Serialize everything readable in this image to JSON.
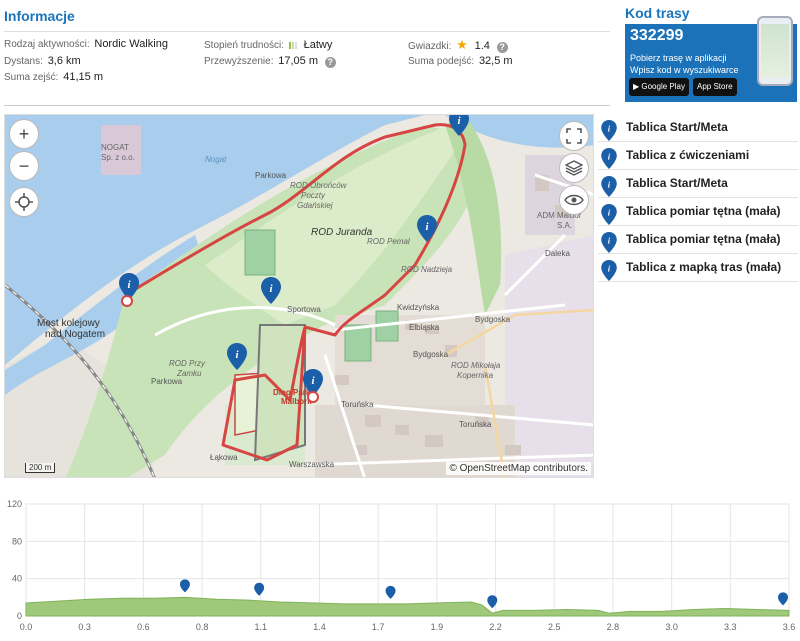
{
  "info": {
    "title": "Informacje",
    "activity_label": "Rodzaj aktywności:",
    "activity_value": "Nordic Walking",
    "difficulty_label": "Stopień trudności:",
    "difficulty_value": "Łatwy",
    "stars_label": "Gwiazdki:",
    "stars_value": "1.4",
    "distance_label": "Dystans:",
    "distance_value": "3,6 km",
    "elevation_label": "Przewyższenie:",
    "elevation_value": "17,05 m",
    "ascent_label": "Suma podejść:",
    "ascent_value": "32,5 m",
    "descent_label": "Suma zejść:",
    "descent_value": "41,15 m"
  },
  "kod": {
    "title": "Kod trasy",
    "code": "332299",
    "line1": "Pobierz trasę w aplikacji",
    "line2": "Wpisz kod w wyszukiwarce",
    "google_play": "Google Play",
    "app_store": "App Store"
  },
  "map": {
    "zoom_in": "+",
    "zoom_out": "−",
    "attribution": "© OpenStreetMap contributors.",
    "scale": "200 m",
    "labels": {
      "nogat_company": "NOGAT",
      "nogat_company2": "Sp. z o.o.",
      "river": "Nogat",
      "parkowa": "Parkowa",
      "rod_obroncow": "ROD Obrońców",
      "rod_obroncow2": "Poczty",
      "rod_obroncow3": "Gdańskiej",
      "rod_juranda": "ROD Juranda",
      "rod_pemal": "ROD Pemal",
      "rod_nadzieja": "ROD Nadzieja",
      "adm": "ADM Malbor",
      "adm2": "S.A.",
      "daleka": "Daleka",
      "most": "Most kolejowy",
      "most2": "nad Nogatem",
      "sportowa": "Sportowa",
      "kwidzynska": "Kwidzyńska",
      "elblaska": "Elbląska",
      "bydgoska": "Bydgoska",
      "bydgoska2": "Bydgoska",
      "rod_przy_zamku": "ROD Przy",
      "rod_przy_zamku2": "Zamku",
      "rod_kopernika": "ROD Mikołaja",
      "rod_kopernika2": "Kopernika",
      "dino": "Dino Park",
      "dino2": "Malbork",
      "torunska": "Toruńska",
      "torunska2": "Toruńska",
      "warszawska": "Warszawska",
      "lakowa": "Łąkowa",
      "parkowa2": "Parkowa"
    }
  },
  "legend": [
    {
      "label": "Tablica Start/Meta"
    },
    {
      "label": "Tablica z ćwiczeniami"
    },
    {
      "label": "Tablica Start/Meta"
    },
    {
      "label": "Tablica pomiar tętna (mała)"
    },
    {
      "label": "Tablica pomiar tętna (mała)"
    },
    {
      "label": "Tablica z mapką tras (mała)"
    }
  ],
  "colors": {
    "accent": "#1a75bb",
    "route": "#d64541",
    "profile_fill": "#9fc87a"
  },
  "chart_data": {
    "type": "area",
    "xlabel": "",
    "ylabel": "",
    "x_ticks": [
      "0.0",
      "0.3",
      "0.6",
      "0.8",
      "1.1",
      "1.4",
      "1.7",
      "1.9",
      "2.2",
      "2.5",
      "2.8",
      "3.0",
      "3.3",
      "3.6"
    ],
    "y_ticks": [
      "0",
      "40",
      "80",
      "120"
    ],
    "xlim": [
      0,
      3.6
    ],
    "ylim": [
      0,
      120
    ],
    "x": [
      0,
      0.15,
      0.3,
      0.45,
      0.6,
      0.75,
      0.9,
      1.05,
      1.2,
      1.35,
      1.5,
      1.65,
      1.8,
      1.95,
      2.1,
      2.15,
      2.2,
      2.25,
      2.4,
      2.55,
      2.7,
      2.75,
      2.85,
      3.0,
      3.15,
      3.3,
      3.45,
      3.6
    ],
    "values": [
      14,
      16,
      18,
      19,
      19,
      20,
      18,
      17,
      15,
      14,
      13,
      13,
      13,
      14,
      15,
      12,
      3,
      6,
      6,
      7,
      6,
      3,
      5,
      5,
      7,
      8,
      7,
      6
    ],
    "markers_x": [
      0.75,
      1.1,
      1.72,
      2.2,
      3.6
    ]
  }
}
